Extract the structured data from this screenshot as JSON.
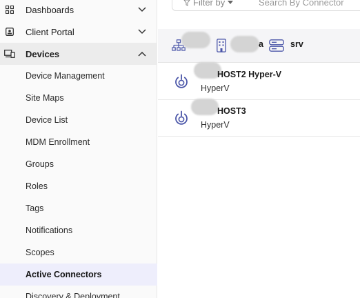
{
  "sidebar": {
    "sections": [
      {
        "label": "Dashboards",
        "icon": "grid-icon",
        "expanded": false
      },
      {
        "label": "Client Portal",
        "icon": "portal-icon",
        "expanded": false
      },
      {
        "label": "Devices",
        "icon": "devices-icon",
        "expanded": true
      }
    ],
    "device_items": [
      "Device Management",
      "Site Maps",
      "Device List",
      "MDM Enrollment",
      "Groups",
      "Roles",
      "Tags",
      "Notifications",
      "Scopes",
      "Active Connectors",
      "Discovery & Deployment"
    ],
    "selected_item": "Active Connectors"
  },
  "toolbar": {
    "filter_label": "Filter by",
    "search_placeholder": "Search By Connector"
  },
  "connector_header": {
    "site_suffix": "a",
    "server_label": "srv"
  },
  "connectors": [
    {
      "name": "HOST2 Hyper-V",
      "type": "HyperV",
      "icon": "power-icon"
    },
    {
      "name": "HOST3",
      "type": "HyperV",
      "icon": "power-icon"
    }
  ],
  "colors": {
    "accent": "#4a55a8",
    "selected_bg": "#eeeefc",
    "section_active_bg": "#ececec"
  }
}
